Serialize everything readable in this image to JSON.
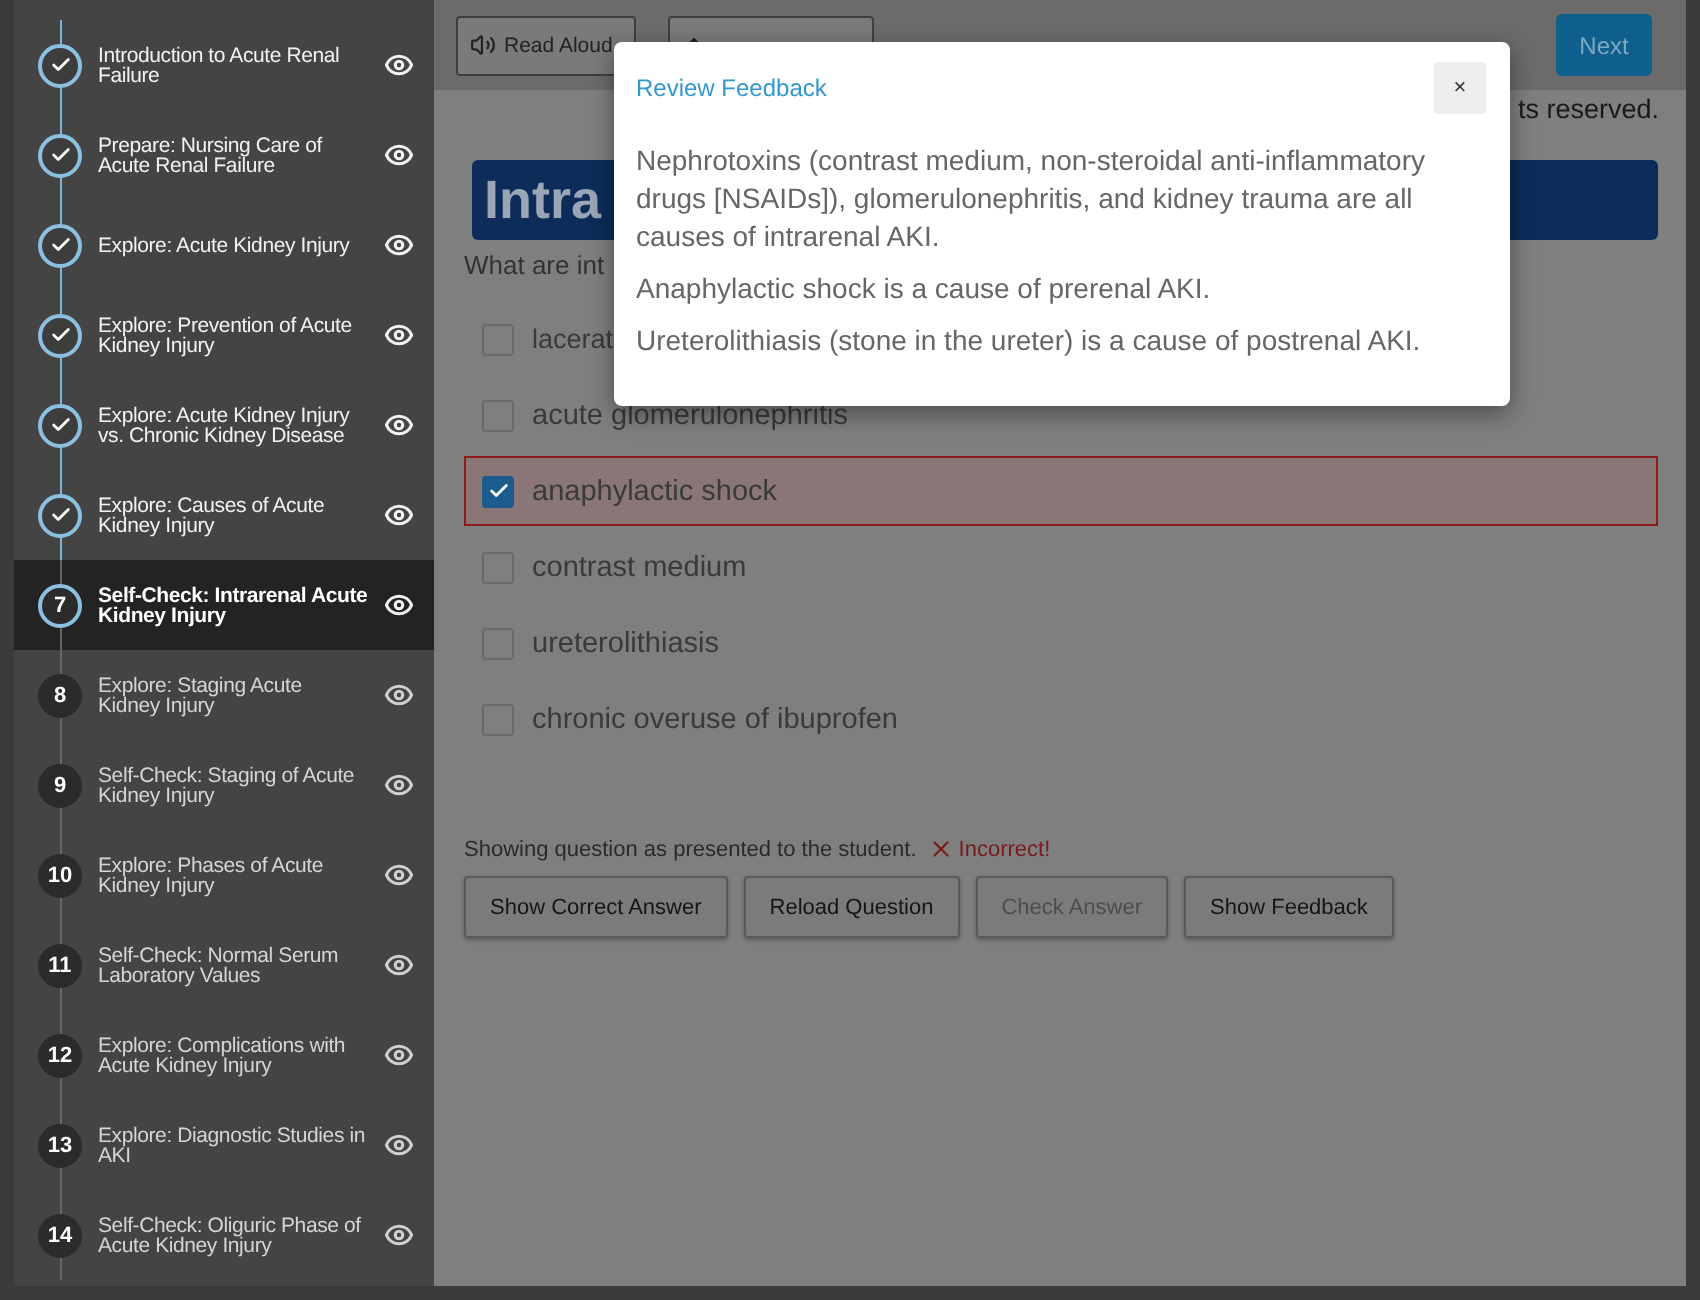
{
  "sidebar": {
    "items": [
      {
        "label": "Introduction to Acute Renal Failure",
        "kind": "done",
        "selected": false
      },
      {
        "label": "Prepare: Nursing Care of Acute Renal Failure",
        "kind": "done",
        "selected": false
      },
      {
        "label": "Explore: Acute Kidney Injury",
        "kind": "done",
        "selected": false
      },
      {
        "label": "Explore: Prevention of Acute Kidney Injury",
        "kind": "done",
        "selected": false
      },
      {
        "label": "Explore: Acute Kidney Injury vs. Chronic Kidney Disease",
        "kind": "done",
        "selected": false
      },
      {
        "label": "Explore: Causes of Acute Kidney Injury",
        "kind": "done",
        "selected": false
      },
      {
        "label": "Self-Check: Intrarenal Acute Kidney Injury",
        "kind": "numbered",
        "number": "7",
        "selected": true
      },
      {
        "label": "Explore: Staging Acute Kidney Injury",
        "kind": "numbered",
        "number": "8",
        "selected": false
      },
      {
        "label": "Self-Check: Staging of Acute Kidney Injury",
        "kind": "numbered",
        "number": "9",
        "selected": false
      },
      {
        "label": "Explore: Phases of Acute Kidney Injury",
        "kind": "numbered",
        "number": "10",
        "selected": false
      },
      {
        "label": "Self-Check: Normal Serum Laboratory Values",
        "kind": "numbered",
        "number": "11",
        "selected": false
      },
      {
        "label": "Explore: Complications with Acute Kidney Injury",
        "kind": "numbered",
        "number": "12",
        "selected": false
      },
      {
        "label": "Explore: Diagnostic Studies in AKI",
        "kind": "numbered",
        "number": "13",
        "selected": false
      },
      {
        "label": "Self-Check: Oliguric Phase of Acute Kidney Injury",
        "kind": "numbered",
        "number": "14",
        "selected": false
      }
    ]
  },
  "toolbar": {
    "read_aloud": "Read Aloud",
    "next": "Next"
  },
  "copyright_fragment": "ts reserved.",
  "title": "Intra",
  "question": "What are int",
  "options": [
    {
      "label": "lacerat",
      "checked": false,
      "marked_incorrect": false
    },
    {
      "label": "acute glomerulonephritis",
      "checked": false,
      "marked_incorrect": false
    },
    {
      "label": "anaphylactic shock",
      "checked": true,
      "marked_incorrect": true
    },
    {
      "label": "contrast medium",
      "checked": false,
      "marked_incorrect": false
    },
    {
      "label": "ureterolithiasis",
      "checked": false,
      "marked_incorrect": false
    },
    {
      "label": "chronic overuse of ibuprofen",
      "checked": false,
      "marked_incorrect": false
    }
  ],
  "status": {
    "text": "Showing question as presented to the student.",
    "result": "Incorrect!"
  },
  "buttons": [
    {
      "label": "Show Correct Answer",
      "disabled": false
    },
    {
      "label": "Reload Question",
      "disabled": false
    },
    {
      "label": "Check Answer",
      "disabled": true
    },
    {
      "label": "Show Feedback",
      "disabled": false
    }
  ],
  "modal": {
    "title": "Review Feedback",
    "close": "×",
    "paragraphs": [
      "Nephrotoxins (contrast medium, non-steroidal anti-inflammatory drugs [NSAIDs]), glomerulonephritis, and kidney trauma are all causes of intrarenal AKI.",
      "Anaphylactic shock is a cause of prerenal AKI.",
      "Ureterolithiasis (stone in the ureter) is a cause of postrenal AKI."
    ]
  }
}
